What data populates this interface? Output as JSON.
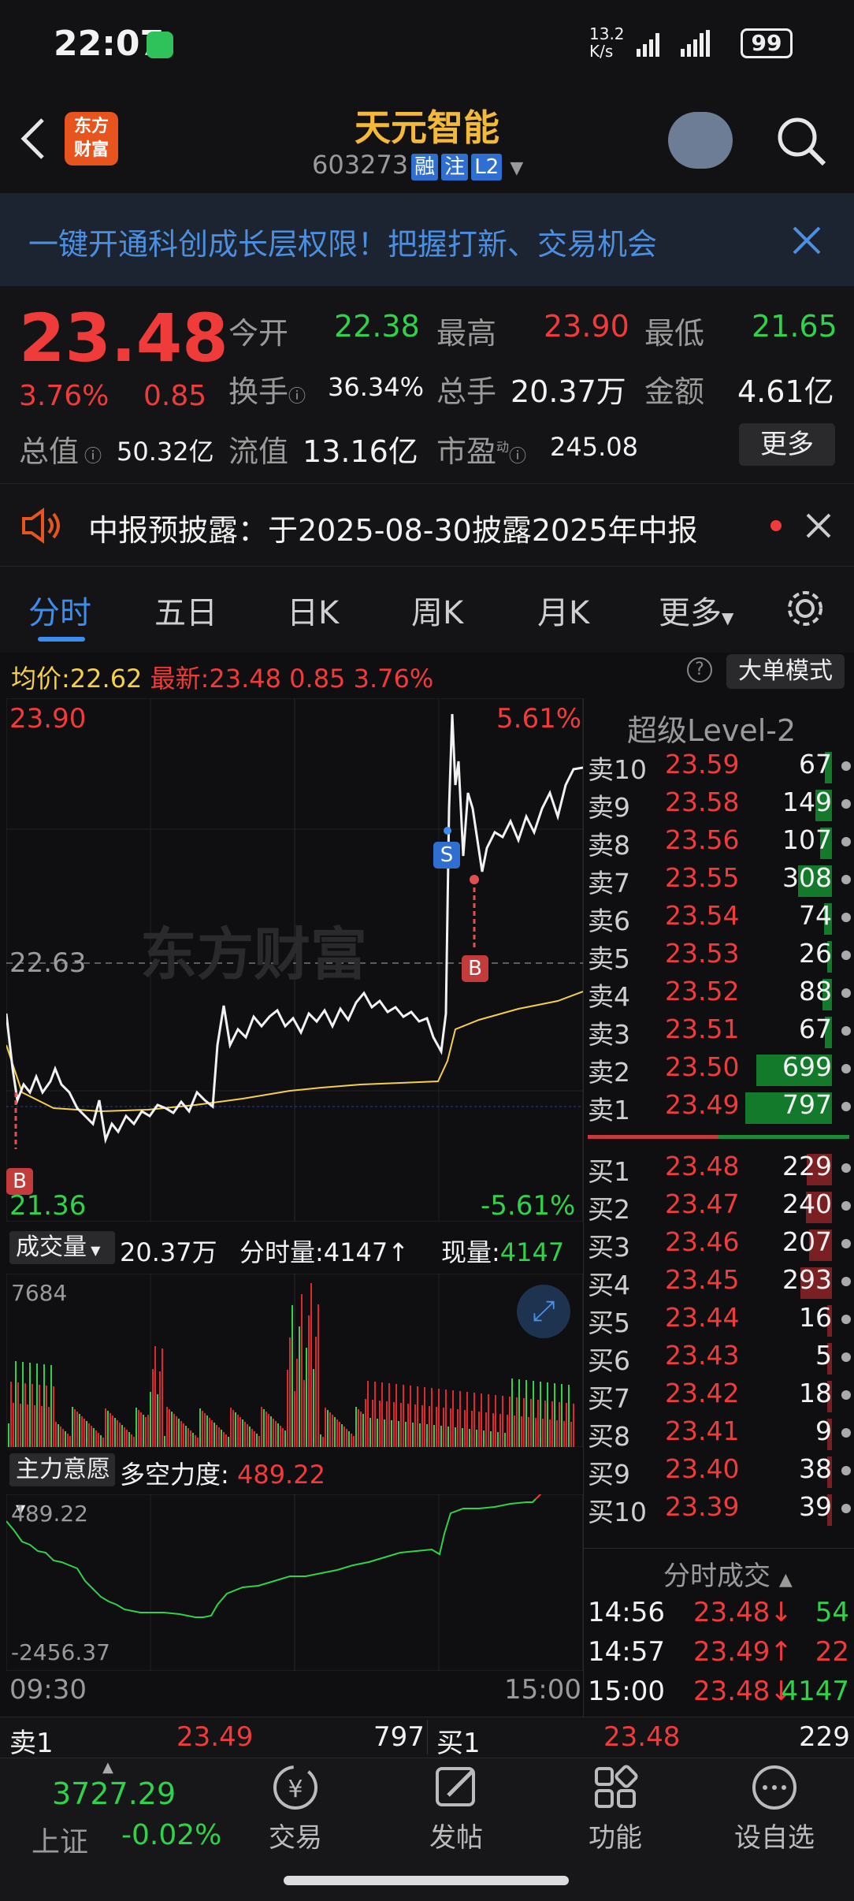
{
  "status": {
    "time": "22:07",
    "net_speed": "13.2",
    "net_unit": "K/s",
    "battery": "99"
  },
  "nav": {
    "title": "天元智能",
    "code": "603273",
    "badges": [
      "融",
      "注",
      "L2"
    ],
    "logo_text_1": "东方",
    "logo_text_2": "财富"
  },
  "banner": {
    "text": "一键开通科创成长层权限！把握打新、交易机会"
  },
  "quote": {
    "price": "23.48",
    "pct": "3.76%",
    "chg": "0.85",
    "open_label": "今开",
    "open": "22.38",
    "high_label": "最高",
    "high": "23.90",
    "low_label": "最低",
    "low": "21.65",
    "turnover_label": "换手",
    "turnover": "36.34%",
    "volume_label": "总手",
    "volume": "20.37万",
    "amount_label": "金额",
    "amount": "4.61亿",
    "mcap_label": "总值",
    "mcap": "50.32亿",
    "float_label": "流值",
    "float": "13.16亿",
    "pe_label": "市盈",
    "pe_sup": "动",
    "pe": "245.08",
    "more": "更多"
  },
  "notice": {
    "text": "中报预披露：于2025-08-30披露2025年中报"
  },
  "tabs": [
    "分时",
    "五日",
    "日K",
    "周K",
    "月K",
    "更多"
  ],
  "info": {
    "avg_label": "均价:",
    "avg": "22.62",
    "latest_label": "最新:",
    "latest": "23.48",
    "chg": "0.85",
    "pct": "3.76%",
    "mode": "大单模式"
  },
  "chart": {
    "top_price": "23.90",
    "top_pct": "5.61%",
    "mid_price": "22.63",
    "bottom_price": "21.36",
    "bottom_pct": "-5.61%",
    "watermark": "东方财富",
    "volume_label": "成交量",
    "volume_total": "20.37万",
    "tick_label": "分时量:4147↑",
    "now_label": "现量:",
    "now_val": "4147",
    "vol_max": "7684",
    "ind_label": "主力意愿",
    "ind_name": "多空力度:",
    "ind_val": "489.22",
    "ind_top": "489.22",
    "ind_bottom": "-2456.37",
    "time_start": "09:30",
    "time_end": "15:00"
  },
  "orderbook": {
    "title": "超级Level-2",
    "sells": [
      {
        "label": "卖10",
        "price": "23.59",
        "vol": "67"
      },
      {
        "label": "卖9",
        "price": "23.58",
        "vol": "149"
      },
      {
        "label": "卖8",
        "price": "23.56",
        "vol": "107"
      },
      {
        "label": "卖7",
        "price": "23.55",
        "vol": "308"
      },
      {
        "label": "卖6",
        "price": "23.54",
        "vol": "74"
      },
      {
        "label": "卖5",
        "price": "23.53",
        "vol": "26"
      },
      {
        "label": "卖4",
        "price": "23.52",
        "vol": "88"
      },
      {
        "label": "卖3",
        "price": "23.51",
        "vol": "67"
      },
      {
        "label": "卖2",
        "price": "23.50",
        "vol": "699"
      },
      {
        "label": "卖1",
        "price": "23.49",
        "vol": "797"
      }
    ],
    "buys": [
      {
        "label": "买1",
        "price": "23.48",
        "vol": "229"
      },
      {
        "label": "买2",
        "price": "23.47",
        "vol": "240"
      },
      {
        "label": "买3",
        "price": "23.46",
        "vol": "207"
      },
      {
        "label": "买4",
        "price": "23.45",
        "vol": "293"
      },
      {
        "label": "买5",
        "price": "23.44",
        "vol": "16"
      },
      {
        "label": "买6",
        "price": "23.43",
        "vol": "5"
      },
      {
        "label": "买7",
        "price": "23.42",
        "vol": "18"
      },
      {
        "label": "买8",
        "price": "23.41",
        "vol": "9"
      },
      {
        "label": "买9",
        "price": "23.40",
        "vol": "38"
      },
      {
        "label": "买10",
        "price": "23.39",
        "vol": "39"
      }
    ],
    "trades_title": "分时成交",
    "trades": [
      {
        "time": "14:56",
        "price": "23.48↓",
        "vol": "54"
      },
      {
        "time": "14:57",
        "price": "23.49↑",
        "vol": "22"
      },
      {
        "time": "15:00",
        "price": "23.48↓",
        "vol": "4147"
      }
    ]
  },
  "bottom_quote": {
    "sell_label": "卖1",
    "sell_price": "23.49",
    "sell_vol": "797",
    "buy_label": "买1",
    "buy_price": "23.48",
    "buy_vol": "229"
  },
  "bottom_nav": {
    "index_val": "3727.29",
    "index_name": "上证",
    "index_pct": "-0.02%",
    "items": [
      "交易",
      "发帖",
      "功能",
      "设自选"
    ]
  },
  "colors": {
    "up": "#f03b3b",
    "down": "#2fd24a",
    "accent": "#3b8df0",
    "title": "#f5b93a"
  }
}
